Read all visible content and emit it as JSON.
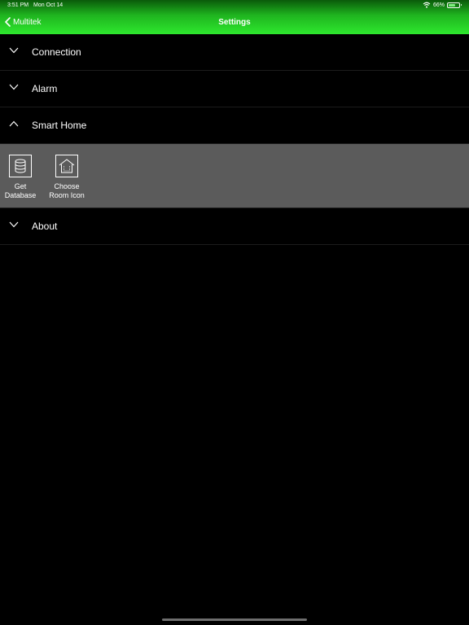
{
  "status_bar": {
    "time": "3:51 PM",
    "date": "Mon Oct 14",
    "battery_percent_text": "66%",
    "battery_level": 0.66
  },
  "nav_bar": {
    "back_label": "Multitek",
    "title": "Settings"
  },
  "sections": {
    "connection": {
      "label": "Connection",
      "expanded": false
    },
    "alarm": {
      "label": "Alarm",
      "expanded": false
    },
    "smart_home": {
      "label": "Smart Home",
      "expanded": true,
      "tiles": [
        {
          "label_line1": "Get",
          "label_line2": "Database",
          "icon": "database-icon"
        },
        {
          "label_line1": "Choose",
          "label_line2": "Room Icon",
          "icon": "house-icon"
        }
      ]
    },
    "about": {
      "label": "About",
      "expanded": false
    }
  },
  "colors": {
    "header_gradient_top": "#0a5a0a",
    "header_gradient_bottom": "#2ee82e",
    "background": "#000000",
    "panel": "#5b5b5b"
  }
}
